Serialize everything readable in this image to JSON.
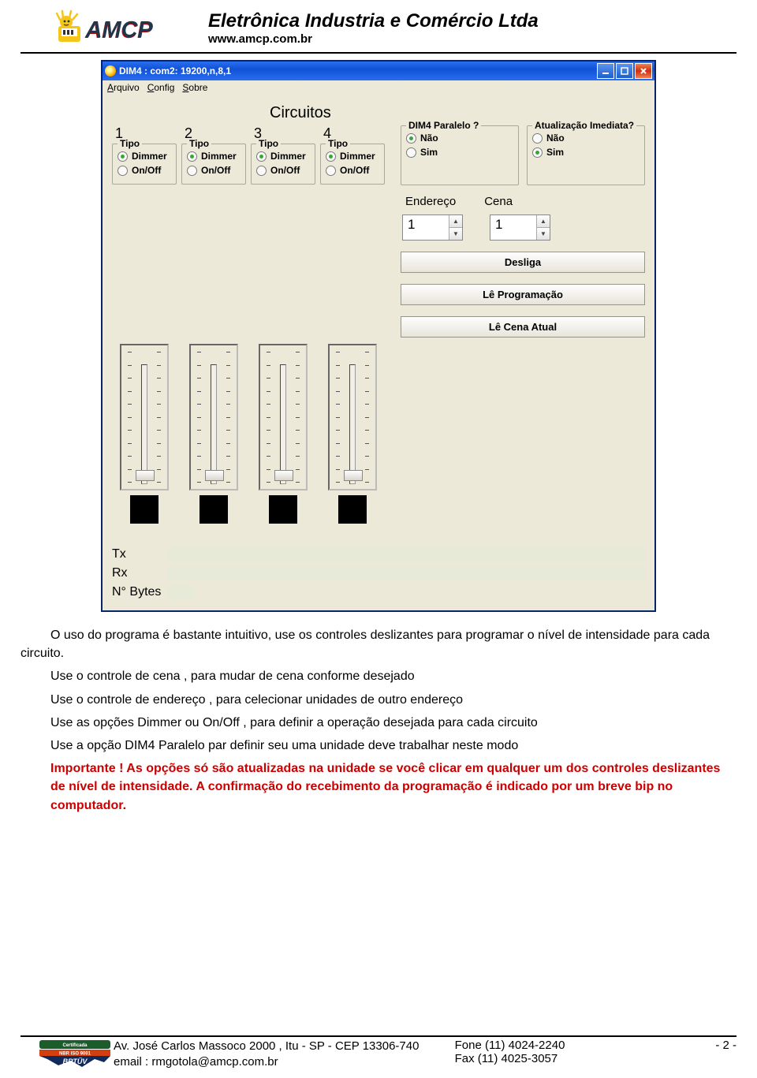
{
  "header": {
    "company": "Eletrônica Industria e Comércio Ltda",
    "website": "www.amcp.com.br"
  },
  "app": {
    "title": "DIM4 : com2: 19200,n,8,1",
    "menu": {
      "arquivo": "Arquivo",
      "config": "Config",
      "sobre": "Sobre"
    },
    "section_title": "Circuitos",
    "circuits": [
      {
        "num": "1",
        "tipo_label": "Tipo",
        "opt1": "Dimmer",
        "opt2": "On/Off"
      },
      {
        "num": "2",
        "tipo_label": "Tipo",
        "opt1": "Dimmer",
        "opt2": "On/Off"
      },
      {
        "num": "3",
        "tipo_label": "Tipo",
        "opt1": "Dimmer",
        "opt2": "On/Off"
      },
      {
        "num": "4",
        "tipo_label": "Tipo",
        "opt1": "Dimmer",
        "opt2": "On/Off"
      }
    ],
    "paralelo": {
      "title": "DIM4 Paralelo ?",
      "nao": "Não",
      "sim": "Sim"
    },
    "atualizacao": {
      "title": "Atualização Imediata?",
      "nao": "Não",
      "sim": "Sim"
    },
    "endereco_label": "Endereço",
    "cena_label": "Cena",
    "endereco_val": "1",
    "cena_val": "1",
    "btn_desliga": "Desliga",
    "btn_le_prog": "Lê Programação",
    "btn_le_cena": "Lê Cena Atual",
    "tx_label": "Tx",
    "rx_label": "Rx",
    "nbytes_label": "N° Bytes"
  },
  "text": {
    "p1": "O uso do programa é bastante intuitivo, use os controles deslizantes para programar o nível de intensidade para cada circuito.",
    "p2": "Use o controle de cena , para mudar de cena conforme desejado",
    "p3": "Use o controle de endereço , para celecionar unidades de outro endereço",
    "p4": "Use as opções Dimmer ou On/Off , para definir a operação desejada para cada circuito",
    "p5": "Use a opção DIM4 Paralelo par definir seu uma unidade deve trabalhar neste modo",
    "p6": "Importante ! As opções só são atualizadas na unidade se você clicar em qualquer um dos controles deslizantes de nível de intensidade. A confirmação do recebimento da programação é indicado por um breve bip no computador."
  },
  "footer": {
    "addr": "Av. José Carlos Massoco 2000 , Itu - SP - CEP 13306-740",
    "email": "email : rmgotola@amcp.com.br",
    "fone": "Fone  (11) 4024-2240",
    "fax": "Fax    (11) 4025-3057",
    "page": "- 2 -"
  }
}
